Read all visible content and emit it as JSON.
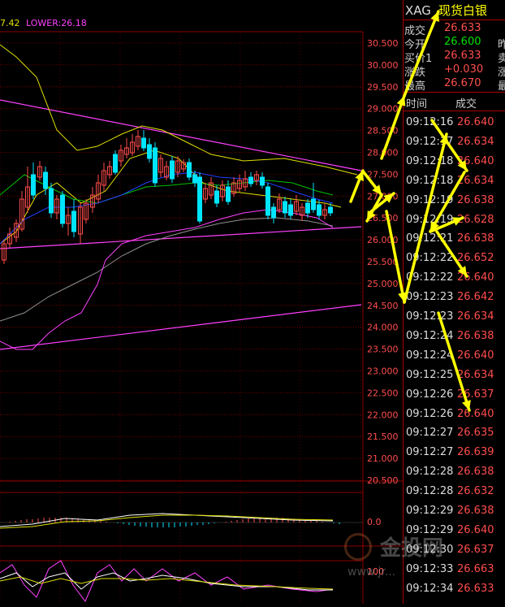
{
  "indicator": {
    "upper_tail": "7.42",
    "lower_label": "LOWER:26.18"
  },
  "price_axis": [
    "30.500",
    "30.000",
    "29.500",
    "29.000",
    "28.500",
    "28.000",
    "27.500",
    "27.000",
    "26.500",
    "26.000",
    "25.500",
    "25.000",
    "24.500",
    "24.000",
    "23.500",
    "23.000",
    "22.500",
    "22.000",
    "21.500",
    "21.000",
    "20.500"
  ],
  "macd_axis_label": "0.0",
  "kdj_axis_label": "100",
  "quote": {
    "symbol": "XAG",
    "name": "现货白银",
    "rows": [
      {
        "label": "成交",
        "value": "26.633",
        "color": "#ff4d4d",
        "label2": ""
      },
      {
        "label": "今开",
        "value": "26.600",
        "color": "#00e000",
        "label2": "昨"
      },
      {
        "label": "买价1",
        "value": "26.633",
        "color": "#ff4d4d",
        "label2": "卖"
      },
      {
        "label": "涨跌",
        "value": "+0.030",
        "color": "#ff4d4d",
        "label2": "涨"
      },
      {
        "label": "最高",
        "value": "26.670",
        "color": "#ff4d4d",
        "label2": "最"
      }
    ]
  },
  "ticks": {
    "time_header": "时间",
    "price_header": "成交",
    "rows": [
      {
        "time": "09:12:16",
        "price": "26.640"
      },
      {
        "time": "09:12:17",
        "price": "26.634"
      },
      {
        "time": "09:12:18",
        "price": "26.640"
      },
      {
        "time": "09:12:18",
        "price": "26.634"
      },
      {
        "time": "09:12:19",
        "price": "26.638"
      },
      {
        "time": "09:12:19",
        "price": "26.628"
      },
      {
        "time": "09:12:21",
        "price": "26.638"
      },
      {
        "time": "09:12:22",
        "price": "26.652"
      },
      {
        "time": "09:12:22",
        "price": "26.640"
      },
      {
        "time": "09:12:23",
        "price": "26.642"
      },
      {
        "time": "09:12:23",
        "price": "26.634"
      },
      {
        "time": "09:12:24",
        "price": "26.638"
      },
      {
        "time": "09:12:24",
        "price": "26.640"
      },
      {
        "time": "09:12:25",
        "price": "26.634"
      },
      {
        "time": "09:12:26",
        "price": "26.637"
      },
      {
        "time": "09:12:26",
        "price": "26.640"
      },
      {
        "time": "09:12:27",
        "price": "26.635"
      },
      {
        "time": "09:12:27",
        "price": "26.639"
      },
      {
        "time": "09:12:28",
        "price": "26.638"
      },
      {
        "time": "09:12:28",
        "price": "26.632"
      },
      {
        "time": "09:12:29",
        "price": "26.638"
      },
      {
        "time": "09:12:29",
        "price": "26.640"
      },
      {
        "time": "09:12:30",
        "price": "26.637"
      },
      {
        "time": "09:12:33",
        "price": "26.663"
      },
      {
        "time": "09:12:34",
        "price": "26.633"
      }
    ]
  },
  "watermark": {
    "text": "金投网",
    "url": "www.jr..."
  },
  "colors": {
    "up": "#ff4d4d",
    "down": "#00e5ff",
    "grid": "#8b0000",
    "ma_yellow": "#e0e000",
    "ma_green": "#00c000",
    "ma_blue": "#2040ff",
    "boll": "#ff40ff",
    "annotation": "#ffff00"
  }
}
